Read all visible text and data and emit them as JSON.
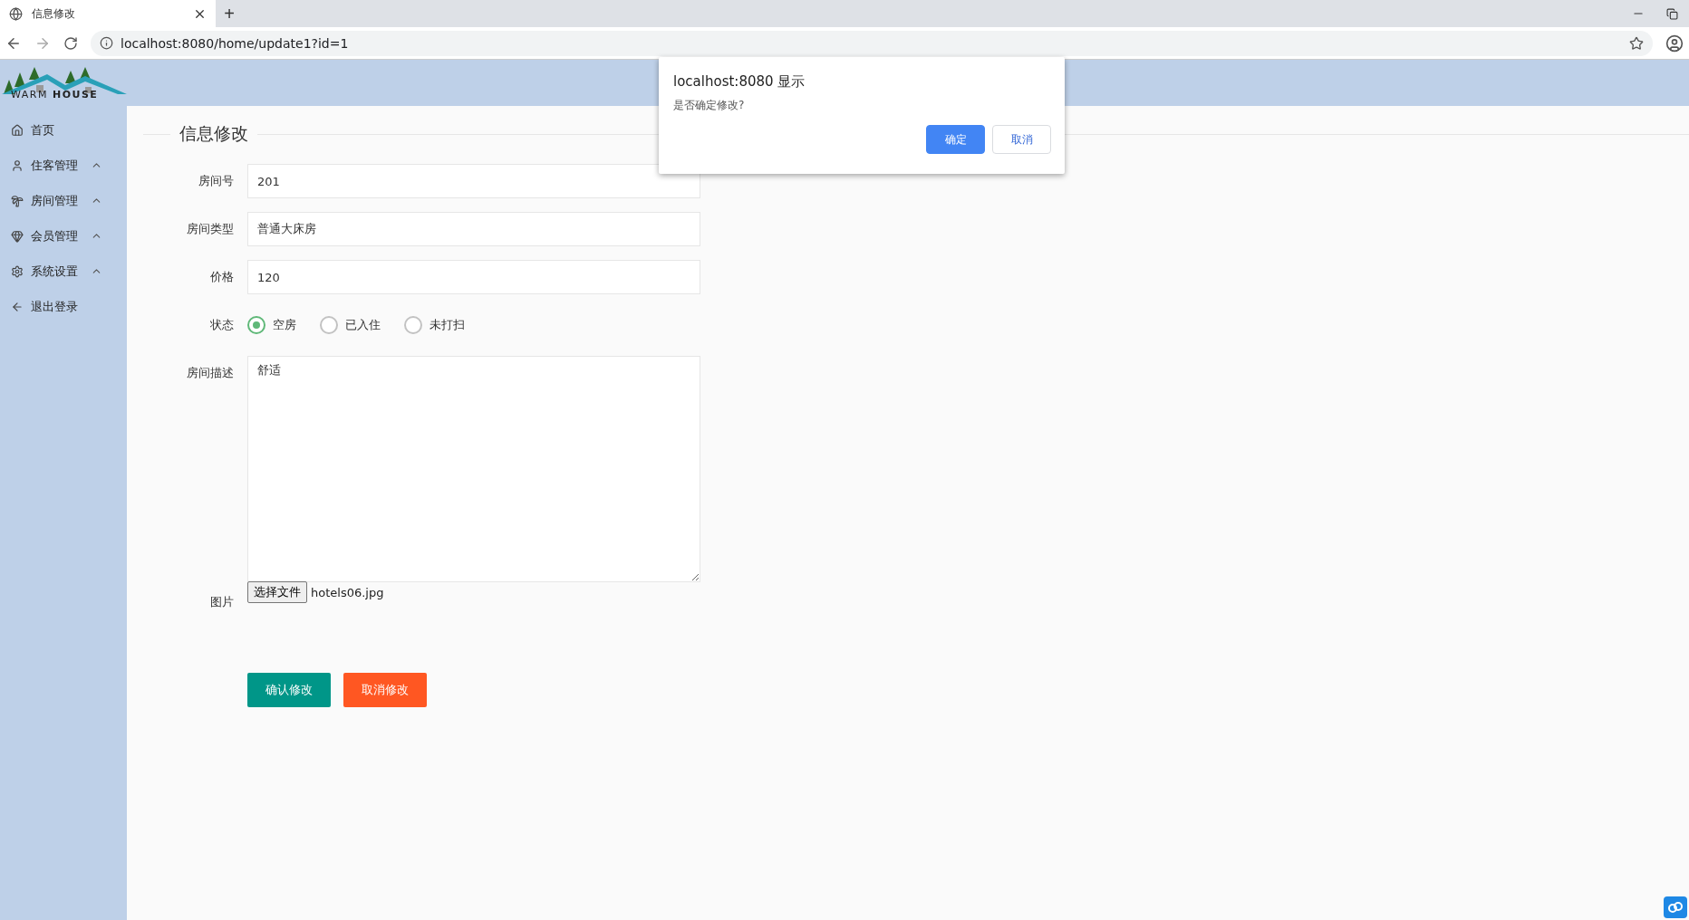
{
  "browser": {
    "tab_title": "信息修改",
    "new_tab": "+",
    "address": "localhost:8080/home/update1?id=1"
  },
  "logo": {
    "text": "WARM **HOUSE**"
  },
  "sidebar": {
    "items": [
      {
        "label": "首页",
        "kind": "link"
      },
      {
        "label": "住客管理",
        "kind": "group"
      },
      {
        "label": "房间管理",
        "kind": "group"
      },
      {
        "label": "会员管理",
        "kind": "group"
      },
      {
        "label": "系统设置",
        "kind": "group"
      },
      {
        "label": "退出登录",
        "kind": "link"
      }
    ]
  },
  "form": {
    "title": "信息修改",
    "fields": [
      {
        "kind": "text",
        "label": "房间号",
        "value": "201"
      },
      {
        "kind": "text",
        "label": "房间类型",
        "value": "普通大床房"
      },
      {
        "kind": "text",
        "label": "价格",
        "value": "120"
      },
      {
        "kind": "radio",
        "label": "状态",
        "options": [
          {
            "label": "空房",
            "selected": true
          },
          {
            "label": "已入住",
            "selected": false
          },
          {
            "label": "未打扫",
            "selected": false
          }
        ]
      },
      {
        "kind": "textarea",
        "label": "房间描述",
        "value": "舒适"
      },
      {
        "kind": "file",
        "label": "图片",
        "button": "选择文件",
        "file_name": "hotels06.jpg"
      }
    ],
    "buttons": [
      {
        "label": "确认修改",
        "kind": "primary"
      },
      {
        "label": "取消修改",
        "kind": "danger"
      }
    ]
  },
  "dialog": {
    "title": "localhost:8080 显示",
    "message": "是否确定修改?",
    "buttons": [
      {
        "label": "确定",
        "kind": "primary"
      },
      {
        "label": "取消",
        "kind": "secondary"
      }
    ]
  }
}
